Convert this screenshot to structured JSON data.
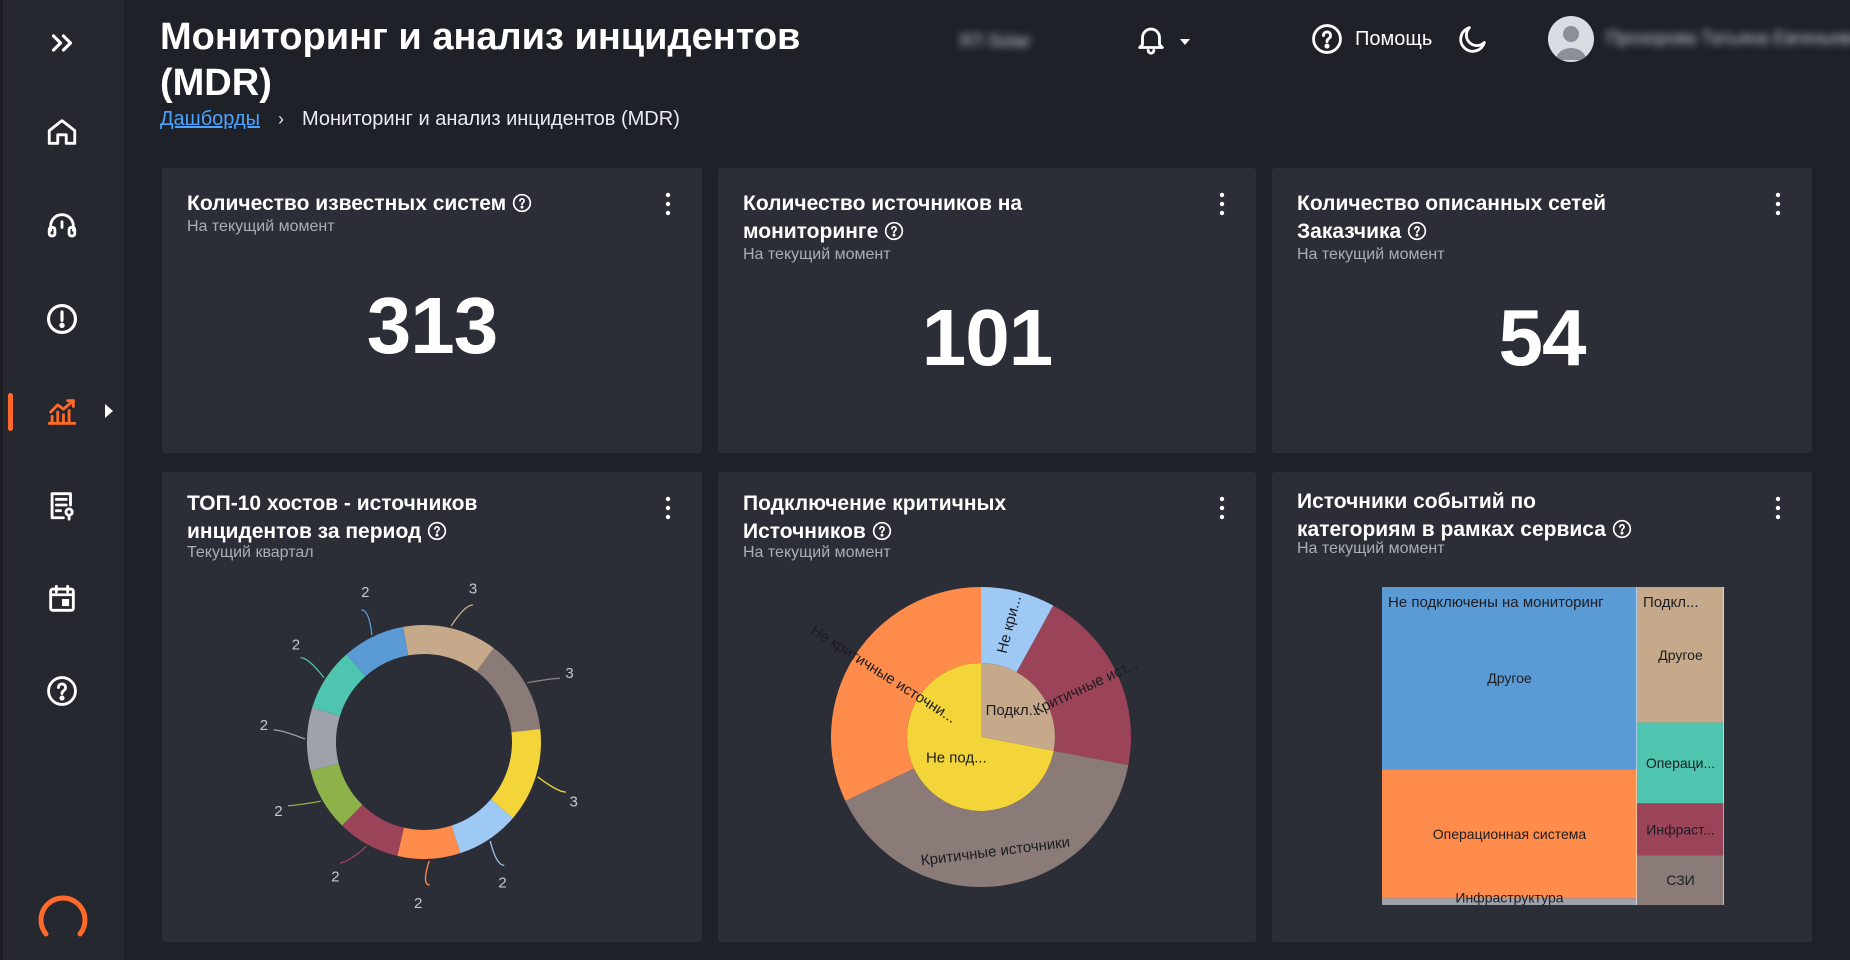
{
  "header": {
    "title": "Мониторинг и анализ инцидентов (MDR)",
    "breadcrumb": {
      "root": "Дашборды",
      "current": "Мониторинг и анализ инцидентов (MDR)"
    },
    "org_selector": "RT-Solar",
    "help_label": "Помощь",
    "user_name": "Прозорова Татьяна Евгеньевна"
  },
  "sidebar": {
    "items": [
      "expand-icon",
      "home-icon",
      "support-icon",
      "incident-icon",
      "analytics-icon",
      "report-icon",
      "calendar-icon",
      "help-icon"
    ],
    "active": "analytics-icon",
    "accent": "#ff6a2a"
  },
  "cards": {
    "systems": {
      "title": "Количество известных систем",
      "subtitle": "На текущий момент",
      "value": "313"
    },
    "sources": {
      "title": "Количество источников на мониторинге",
      "subtitle": "На текущий момент",
      "value": "101"
    },
    "networks": {
      "title": "Количество описанных сетей Заказчика",
      "subtitle": "На текущий момент",
      "value": "54"
    },
    "top_hosts": {
      "title": "ТОП-10 хостов - источников инцидентов за период",
      "subtitle": "Текущий квартал"
    },
    "critical": {
      "title": "Подключение критичных Источников",
      "subtitle": "На текущий момент"
    },
    "categories": {
      "title": "Источники событий по категориям в рамках сервиса",
      "subtitle": "На текущий момент"
    }
  },
  "chart_data": [
    {
      "type": "pie",
      "variant": "donut",
      "values": [
        3,
        3,
        3,
        2,
        2,
        2,
        2,
        2,
        2,
        2
      ],
      "labels": [
        "3",
        "3",
        "3",
        "2",
        "2",
        "2",
        "2",
        "2",
        "2",
        "2"
      ],
      "colors": [
        "#c6a98a",
        "#8b7b78",
        "#f3d53a",
        "#9ec9f5",
        "#ff8c4a",
        "#9b4358",
        "#8db24a",
        "#9ea2ab",
        "#4fc4ae",
        "#5b9bd5"
      ]
    },
    {
      "type": "pie",
      "variant": "sunburst",
      "inner": [
        {
          "label": "Подкл...",
          "value": 28,
          "color": "#c6a98a"
        },
        {
          "label": "Не под...",
          "value": 72,
          "color": "#f3d53a"
        }
      ],
      "outer": [
        {
          "label": "Не кри...",
          "value": 8,
          "color": "#9ec9f5"
        },
        {
          "label": "Критичные ист...",
          "value": 20,
          "color": "#9b4358"
        },
        {
          "label": "Критичные источники",
          "value": 40,
          "color": "#8b7b78"
        },
        {
          "label": "Не критичные источни...",
          "value": 32,
          "color": "#ff8c4a"
        }
      ]
    },
    {
      "type": "heatmap",
      "variant": "treemap",
      "groups": [
        {
          "name": "Не подключены на мониторинг",
          "children": [
            {
              "label": "Другое",
              "value": 41,
              "color": "#5b9bd5"
            },
            {
              "label": "Операционная система",
              "value": 29,
              "color": "#ff8c4a"
            },
            {
              "label": "Инфраструктура",
              "value": 1.5,
              "color": "#9ea2ab"
            }
          ]
        },
        {
          "name": "Подкл...",
          "children": [
            {
              "label": "Другое",
              "value": 10.4,
              "color": "#c6a98a"
            },
            {
              "label": "Операци...",
              "value": 6.2,
              "color": "#4fc4ae"
            },
            {
              "label": "Инфраст...",
              "value": 4,
              "color": "#9b4358"
            },
            {
              "label": "СЗИ",
              "value": 3.8,
              "color": "#8b7b78"
            }
          ]
        }
      ]
    }
  ]
}
